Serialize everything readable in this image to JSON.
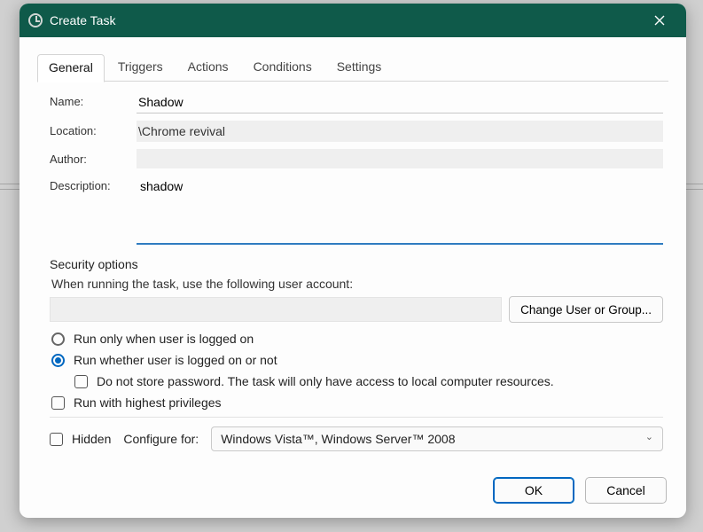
{
  "window": {
    "title": "Create Task"
  },
  "tabs": {
    "general": "General",
    "triggers": "Triggers",
    "actions": "Actions",
    "conditions": "Conditions",
    "settings": "Settings"
  },
  "labels": {
    "name": "Name:",
    "location": "Location:",
    "author": "Author:",
    "description": "Description:",
    "security": "Security options",
    "running_as": "When running the task, use the following user account:",
    "change_user": "Change User or Group...",
    "run_logged_on": "Run only when user is logged on",
    "run_always": "Run whether user is logged on or not",
    "no_store_pw": "Do not store password.  The task will only have access to local computer resources.",
    "highest_priv": "Run with highest privileges",
    "hidden": "Hidden",
    "configure_for": "Configure for:"
  },
  "values": {
    "name": "Shadow",
    "location": "\\Chrome revival",
    "author": "",
    "description": "shadow",
    "user_account": "",
    "configure_for": "Windows Vista™, Windows Server™ 2008"
  },
  "footer": {
    "ok": "OK",
    "cancel": "Cancel"
  }
}
